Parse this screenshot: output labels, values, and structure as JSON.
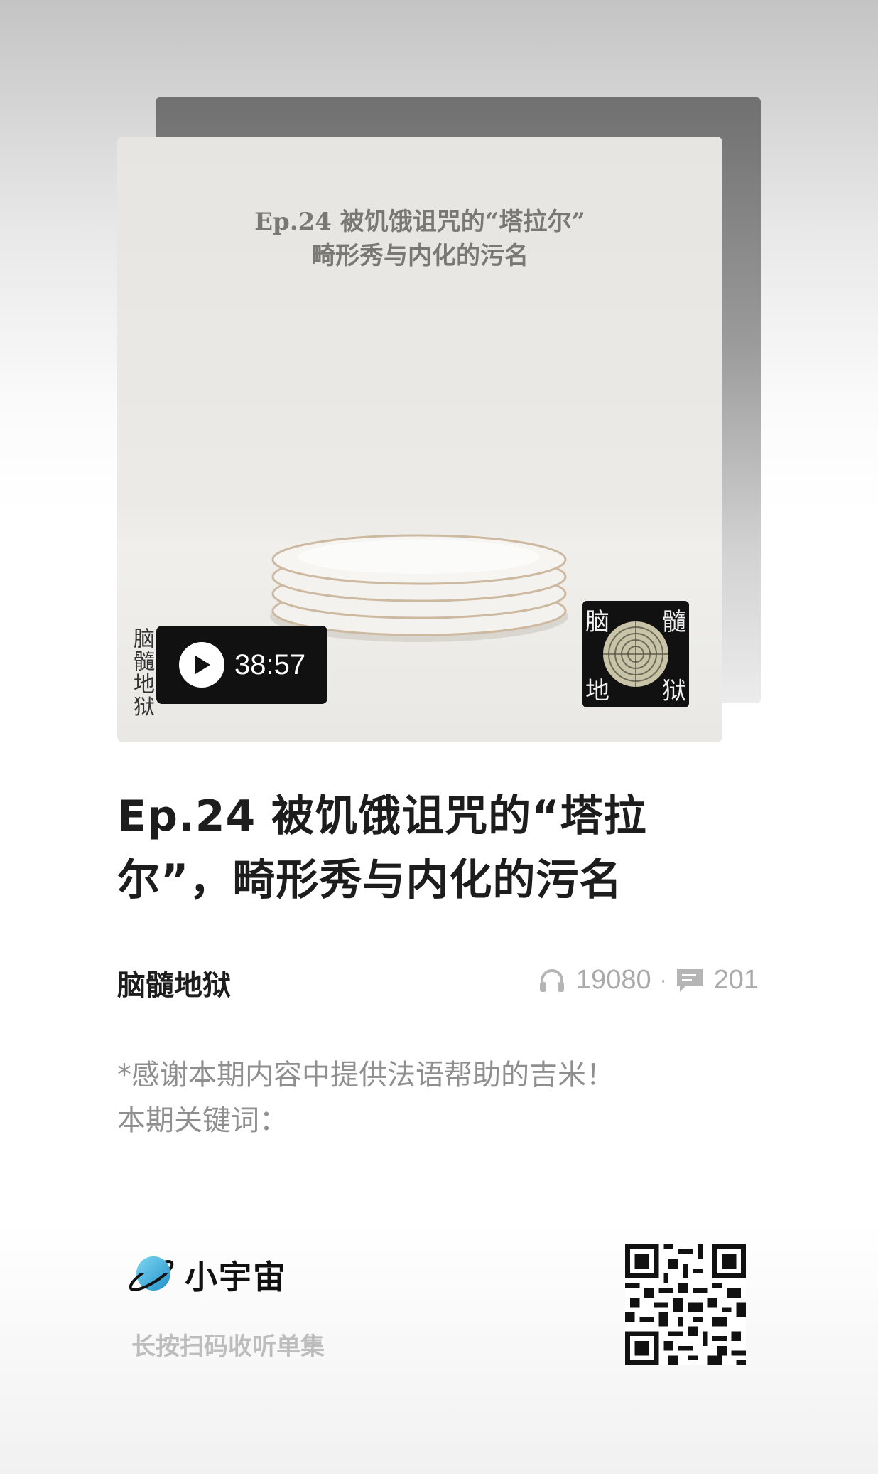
{
  "cover": {
    "title_line1": "Ep.24 被饥饿诅咒的“塔拉尔”",
    "title_line2": "畸形秀与内化的污名",
    "brush_text": "脑髓地狱",
    "logo_chars": [
      "脑",
      "髓",
      "地",
      "狱"
    ]
  },
  "player": {
    "duration": "38:57",
    "play_icon": "play-icon"
  },
  "episode": {
    "title": "Ep.24 被饥饿诅咒的“塔拉尔”，畸形秀与内化的污名",
    "podcast": "脑髓地狱",
    "plays": "19080",
    "separator": "·",
    "comments": "201",
    "description_line1": "*感谢本期内容中提供法语帮助的吉米！",
    "description_line2": "本期关键词："
  },
  "footer": {
    "brand_name": "小宇宙",
    "tip": "长按扫码收听单集"
  },
  "colors": {
    "brand_blue": "#4fc3e8",
    "text_dark": "#1d1d1d",
    "text_gray": "#8f8f8f"
  }
}
